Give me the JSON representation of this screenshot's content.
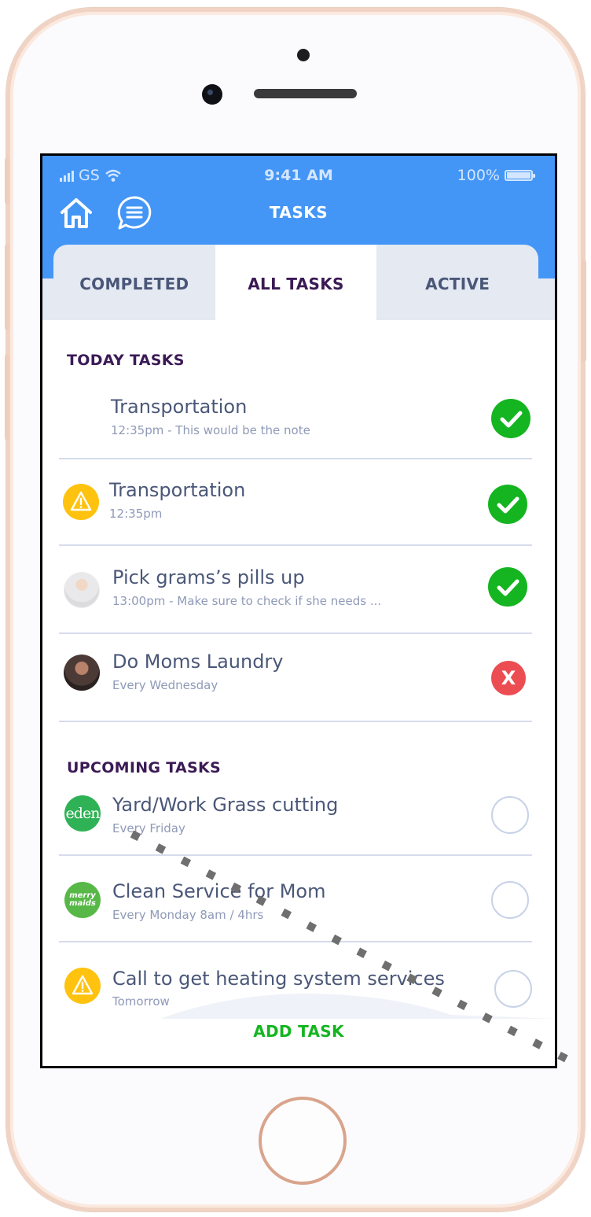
{
  "status_bar": {
    "carrier": "GS",
    "time": "9:41 AM",
    "battery": "100%"
  },
  "header": {
    "title": "TASKS",
    "home_icon": "home-icon",
    "chat_icon": "chat-icon"
  },
  "tabs": [
    {
      "label": "COMPLETED",
      "active": false
    },
    {
      "label": "ALL TASKS",
      "active": true
    },
    {
      "label": "ACTIVE",
      "active": false
    }
  ],
  "today": {
    "title": "TODAY TASKS",
    "items": [
      {
        "title": "Transportation",
        "sub": "12:35pm - This would be the note",
        "lead": "none",
        "status": "done"
      },
      {
        "title": "Transportation",
        "sub": "12:35pm",
        "lead": "warning-icon",
        "status": "done"
      },
      {
        "title": "Pick grams’s pills up",
        "sub": "13:00pm - Make sure to check if she needs ...",
        "lead": "avatar",
        "status": "done"
      },
      {
        "title": "Do Moms Laundry",
        "sub": "Every Wednesday",
        "lead": "avatar",
        "status": "failed"
      }
    ]
  },
  "upcoming": {
    "title": "UPCOMING TASKS",
    "items": [
      {
        "title": "Yard/Work Grass cutting",
        "sub": "Every Friday",
        "lead": "eden-logo",
        "logo_text": "eden",
        "status": "pending"
      },
      {
        "title": "Clean Service for Mom",
        "sub": "Every Monday 8am / 4hrs",
        "lead": "merry-maids-logo",
        "logo_text": "merry maids",
        "status": "pending"
      },
      {
        "title": "Call to get heating system services",
        "sub": "Tomorrow",
        "lead": "warning-icon",
        "status": "pending"
      }
    ]
  },
  "footer": {
    "add_label": "ADD TASK"
  },
  "status_marks": {
    "failed": "X"
  },
  "colors": {
    "header_blue": "#4496f6",
    "done_green": "#14b520",
    "failed_red": "#ec4d52",
    "warning_yellow": "#ffc20e",
    "section_purple": "#3b1a55"
  }
}
